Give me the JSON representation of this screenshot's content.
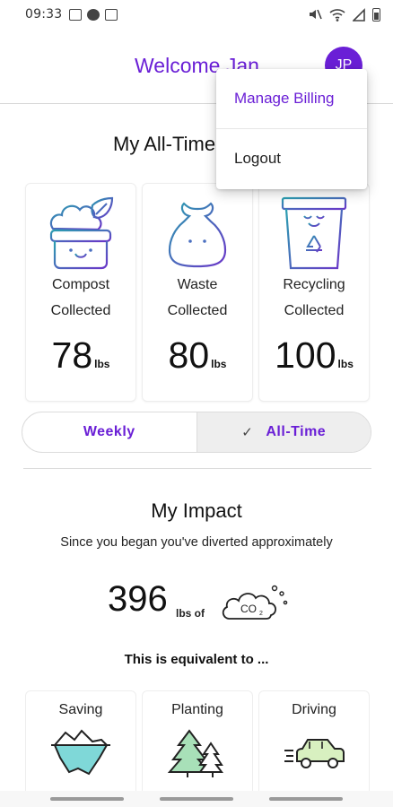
{
  "status_bar": {
    "time": "09:33"
  },
  "header": {
    "welcome": "Welcome Jan",
    "avatar_initials": "JP"
  },
  "menu": {
    "manage_billing": "Manage Billing",
    "logout": "Logout"
  },
  "stats": {
    "title": "My All-Time",
    "cards": [
      {
        "icon": "compost-bin-icon",
        "label1": "Compost",
        "label2": "Collected",
        "value": "78",
        "unit": "lbs"
      },
      {
        "icon": "waste-bag-icon",
        "label1": "Waste",
        "label2": "Collected",
        "value": "80",
        "unit": "lbs"
      },
      {
        "icon": "recycling-bin-icon",
        "label1": "Recycling",
        "label2": "Collected",
        "value": "100",
        "unit": "lbs"
      }
    ]
  },
  "toggle": {
    "weekly": "Weekly",
    "all_time": "All-Time",
    "selected": "All-Time"
  },
  "impact": {
    "title": "My Impact",
    "subtitle": "Since you began you've diverted approximately",
    "value": "396",
    "unit": "lbs of",
    "co2_label": "CO",
    "co2_sub": "2",
    "equivalent": "This is equivalent to ...",
    "cards": [
      {
        "label": "Saving",
        "icon": "iceberg-icon"
      },
      {
        "label": "Planting",
        "icon": "trees-icon"
      },
      {
        "label": "Driving",
        "icon": "car-icon"
      }
    ]
  },
  "colors": {
    "accent": "#6a1fd6",
    "icon_gradient_start": "#2a9fb0",
    "icon_gradient_end": "#6a35c8"
  }
}
